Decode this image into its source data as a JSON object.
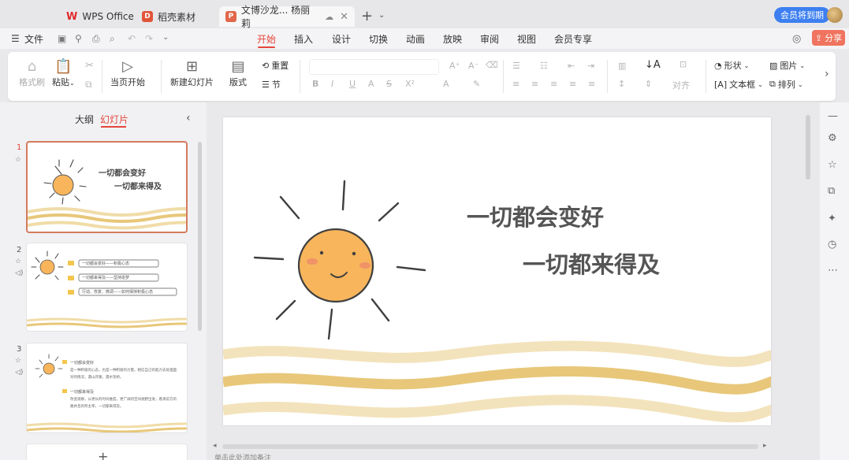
{
  "tabs": {
    "items": [
      {
        "label": "WPS Office"
      },
      {
        "label": "稻壳素材"
      },
      {
        "label": "文博沙龙... 杨丽莉"
      }
    ],
    "add_label": "+",
    "more_label": "⌄"
  },
  "header": {
    "vip_label": "会员将到期"
  },
  "menu": {
    "file_label": "文件",
    "items": [
      "开始",
      "插入",
      "设计",
      "切换",
      "动画",
      "放映",
      "审阅",
      "视图",
      "会员专享"
    ],
    "share_label": "分享"
  },
  "toolbar": {
    "format_painter": "格式刷",
    "paste": "粘贴",
    "paste_caret": "⌄",
    "play_from_current": "当页开始",
    "new_slide": "新建幻灯片",
    "layout": "版式",
    "reset": "重置",
    "section": "节",
    "align": "对齐",
    "shape": "形状",
    "picture": "图片",
    "textbox": "文本框",
    "arrange": "排列"
  },
  "left_panel": {
    "tab_outline": "大纲",
    "tab_slides": "幻灯片",
    "collapse": "‹",
    "slides": [
      {
        "number": "1",
        "line1": "一切都会变好",
        "line2": "一切都来得及"
      },
      {
        "number": "2",
        "items": [
          "一切都会变好——积极心态",
          "一切都来得及——坚持逐梦",
          "行动、恢复、微调——如何保持积极心态"
        ]
      },
      {
        "number": "3",
        "heading1": "一切都会变好",
        "para1": "是一种积极的心态，也是一种积极的力量。相信自己有能力去处理面对的情况，遇山开路，遇水架桥。",
        "heading2": "一切都来得及",
        "para2": "改变观察，从更长的时间维度，更广阔的空间视野出发，看清前方的路并且有所主宰，一切都来得及。"
      }
    ],
    "add_slide": "+"
  },
  "slide": {
    "title_line1": "一切都会变好",
    "title_line2": "一切都来得及"
  },
  "status": {
    "notes_hint": "单击此处添加备注"
  },
  "colors": {
    "accent": "#e6453b",
    "sun_fill": "#f8b55c",
    "wave": "#e8c77a",
    "vip": "#3d7ff0",
    "share": "#f0745f"
  }
}
